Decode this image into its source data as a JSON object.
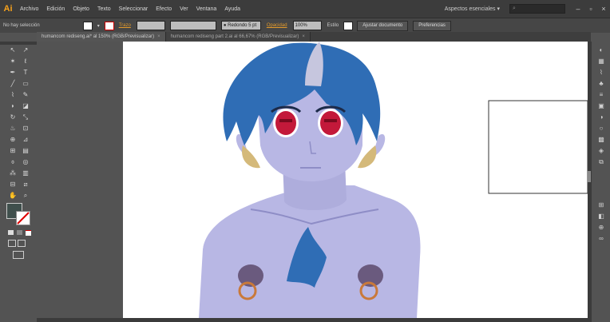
{
  "app": {
    "logo": "Ai"
  },
  "menu": [
    "Archivo",
    "Edición",
    "Objeto",
    "Texto",
    "Seleccionar",
    "Efecto",
    "Ver",
    "Ventana",
    "Ayuda"
  ],
  "workspace": "Aspectos esenciales ▾",
  "window_controls": [
    "–",
    "▫",
    "×"
  ],
  "control_bar": {
    "selection": "No hay selección",
    "stroke_label": "Trazo",
    "brush": "● Redondo 5 pt",
    "opacity_label": "Opacidad",
    "opacity_value": "100%",
    "style_label": "Estilo",
    "doc_setup": "Ajustar documento",
    "prefs": "Preferencias"
  },
  "tabs": [
    {
      "label": "humancom rediseng.ai* al 150% (RGB/Previsualizar)",
      "active": true
    },
    {
      "label": "humancom rediseng part 2.ai al 66,67% (RGB/Previsualizar)",
      "active": false
    }
  ],
  "colors": {
    "hair": "#2f6db5",
    "skin": "#b8b7e4",
    "eye": "#c3193a",
    "nipple": "#6a5a7e",
    "ring": "#c9793a",
    "fill_swatch": "#3f4f4c"
  },
  "icons": {
    "tools": [
      "selection-icon",
      "direct-selection-icon",
      "magic-wand-icon",
      "lasso-icon",
      "pen-icon",
      "type-icon",
      "line-icon",
      "rectangle-icon",
      "brush-icon",
      "pencil-icon",
      "blob-brush-icon",
      "eraser-icon",
      "rotate-icon",
      "scale-icon",
      "warp-icon",
      "free-transform-icon",
      "shape-builder-icon",
      "perspective-icon",
      "mesh-icon",
      "gradient-icon",
      "eyedropper-icon",
      "blend-icon",
      "symbol-sprayer-icon",
      "graph-icon",
      "artboard-icon",
      "slice-icon",
      "hand-icon",
      "zoom-icon"
    ],
    "panels": [
      "color-panel-icon",
      "swatches-panel-icon",
      "brushes-panel-icon",
      "symbols-panel-icon",
      "stroke-panel-icon",
      "gradient-panel-icon",
      "transparency-panel-icon",
      "appearance-panel-icon",
      "graphic-styles-panel-icon",
      "layers-panel-icon",
      "artboards-panel-icon",
      "align-panel-icon",
      "pathfinder-panel-icon",
      "transform-panel-icon",
      "links-panel-icon"
    ]
  }
}
